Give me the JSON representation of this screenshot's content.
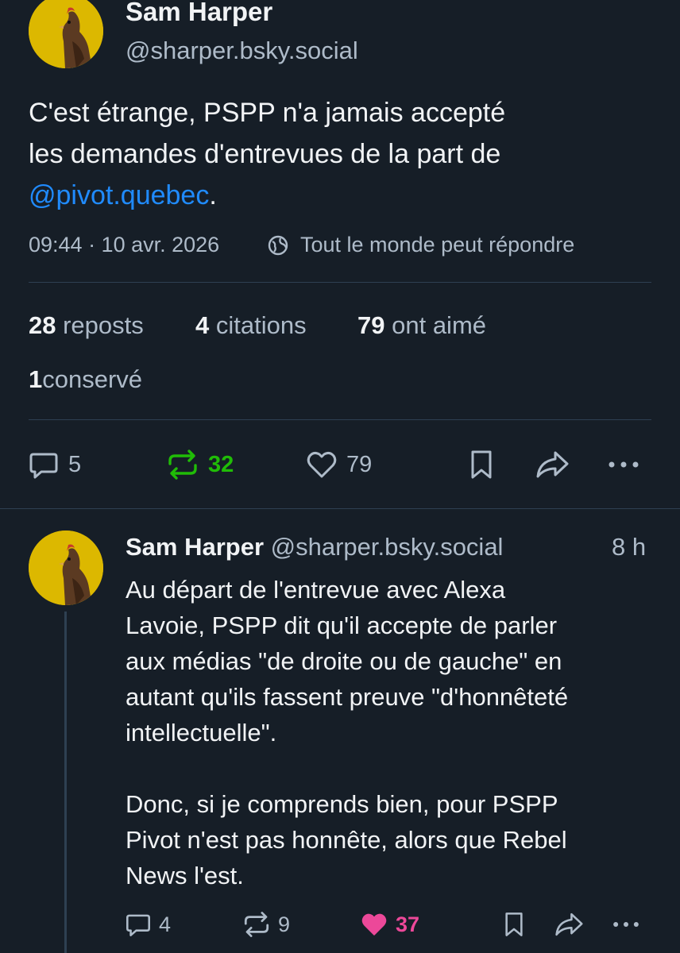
{
  "colors": {
    "background": "#161e27",
    "text": "#f1f3f5",
    "muted": "#aebbc9",
    "link": "#208bfe",
    "repost_active": "#20bc07",
    "like_active": "#ec4899",
    "divider": "#2e4052"
  },
  "main_post": {
    "author_name": "Sam Harper",
    "author_handle": "@sharper.bsky.social",
    "text_line1": "C'est étrange, PSPP n'a jamais accepté",
    "text_line2": "les demandes d'entrevues de la part de",
    "mention": "@pivot.quebec",
    "mention_suffix": ".",
    "timestamp": "09:44 · 10 avr. 2026",
    "reply_setting_icon": "globe-icon",
    "reply_setting": "Tout le monde peut répondre",
    "stats": {
      "reposts_count": "28",
      "reposts_label": "reposts",
      "quotes_count": "4",
      "quotes_label": "citations",
      "likes_count": "79",
      "likes_label": "ont aimé",
      "saves_count": "1",
      "saves_label": "conservé"
    },
    "actions": {
      "reply_icon": "reply-icon",
      "reply_count": "5",
      "repost_icon": "repost-icon",
      "repost_count": "32",
      "like_icon": "heart-icon",
      "like_count": "79",
      "bookmark_icon": "bookmark-icon",
      "share_icon": "share-icon",
      "more_icon": "more-icon"
    }
  },
  "reply_post": {
    "author_name": "Sam Harper",
    "author_handle": "@sharper.bsky.social",
    "time_ago": "8 h",
    "lines": [
      "Au départ de l'entrevue avec Alexa",
      "Lavoie, PSPP dit qu'il accepte de parler",
      "aux médias \"de droite ou de gauche\" en",
      "autant qu'ils fassent preuve \"d'honnêteté",
      "intellectuelle\".",
      "",
      "Donc, si je comprends bien, pour PSPP",
      "Pivot n'est pas honnête, alors que Rebel",
      "News l'est."
    ],
    "actions": {
      "reply_icon": "reply-icon",
      "reply_count": "4",
      "repost_icon": "repost-icon",
      "repost_count": "9",
      "like_icon": "heart-filled-icon",
      "like_count": "37",
      "bookmark_icon": "bookmark-icon",
      "share_icon": "share-icon",
      "more_icon": "more-icon"
    }
  }
}
